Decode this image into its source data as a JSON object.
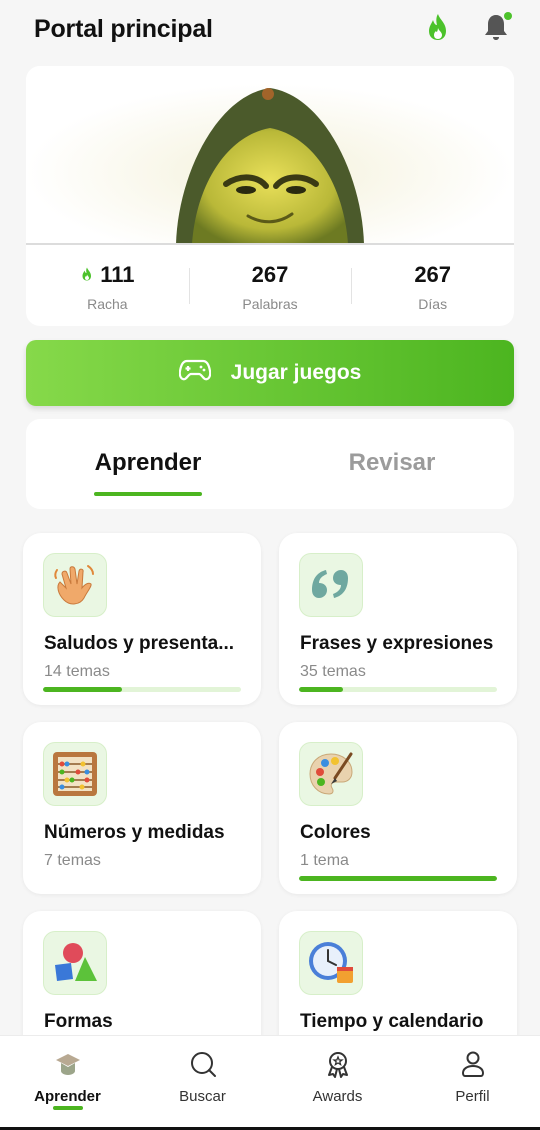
{
  "header": {
    "title": "Portal principal"
  },
  "stats": [
    {
      "value": "111",
      "label": "Racha",
      "icon": "flame-icon"
    },
    {
      "value": "267",
      "label": "Palabras"
    },
    {
      "value": "267",
      "label": "Días"
    }
  ],
  "play_button": {
    "label": "Jugar juegos",
    "icon": "gamepad-icon"
  },
  "tabs": [
    {
      "label": "Aprender",
      "active": true
    },
    {
      "label": "Revisar",
      "active": false
    }
  ],
  "categories": [
    {
      "title": "Saludos y presenta...",
      "subtitle": "14 temas",
      "progress": 0.4,
      "icon": "waving-hand-icon"
    },
    {
      "title": "Frases y expresiones",
      "subtitle": "35 temas",
      "progress": 0.22,
      "icon": "quote-marks-icon"
    },
    {
      "title": "Números y medidas",
      "subtitle": "7 temas",
      "progress": null,
      "icon": "abacus-icon"
    },
    {
      "title": "Colores",
      "subtitle": "1 tema",
      "progress": 1.0,
      "icon": "palette-icon"
    },
    {
      "title": "Formas",
      "subtitle": "",
      "progress": null,
      "icon": "shapes-icon"
    },
    {
      "title": "Tiempo y calendario",
      "subtitle": "",
      "progress": null,
      "icon": "clock-calendar-icon"
    }
  ],
  "nav": [
    {
      "label": "Aprender",
      "icon": "graduation-cap-icon",
      "active": true
    },
    {
      "label": "Buscar",
      "icon": "search-icon",
      "active": false
    },
    {
      "label": "Awards",
      "icon": "award-icon",
      "active": false
    },
    {
      "label": "Perfil",
      "icon": "person-icon",
      "active": false
    }
  ],
  "colors": {
    "accent": "#4cb520",
    "accent_light": "#86d94a",
    "background": "#f6f6f6"
  }
}
